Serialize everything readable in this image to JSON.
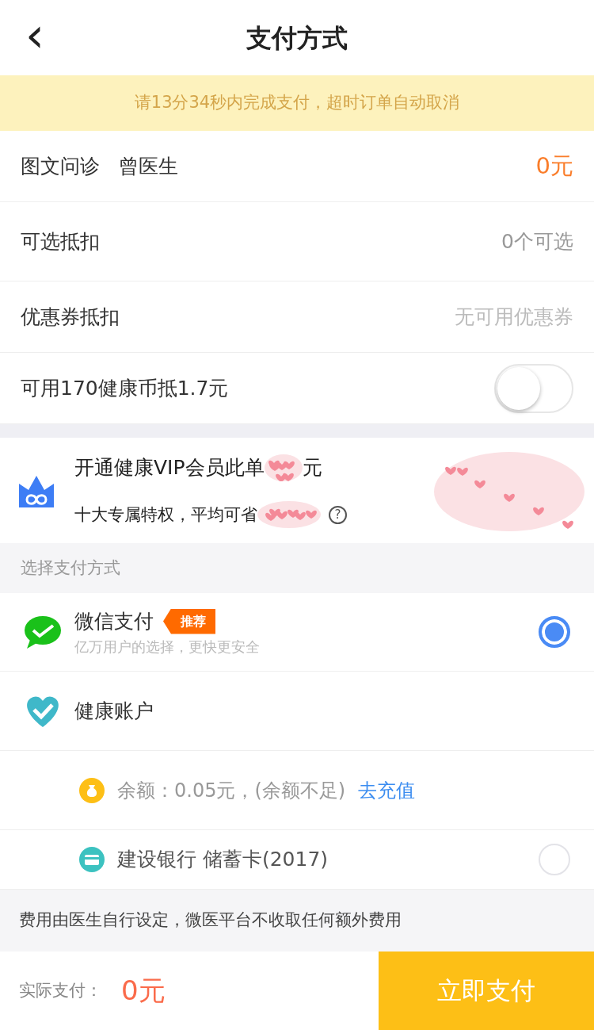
{
  "header": {
    "back": "‹",
    "title": "支付方式"
  },
  "notice": "请13分34秒内完成支付，超时订单自动取消",
  "order_rows": [
    {
      "kind": "text",
      "label": "图文问诊",
      "extra": "曾医生",
      "value": "0元",
      "highlight": true
    },
    {
      "kind": "text",
      "label": "可选抵扣",
      "value": "0个可选",
      "highlight": false
    },
    {
      "kind": "text",
      "label": "优惠券抵扣",
      "value": "无可用优惠券",
      "highlight": false,
      "muted": true
    },
    {
      "kind": "switch",
      "label": "可用170健康币抵1.7元",
      "on": false
    }
  ],
  "vip": {
    "title": "开通健康VIP会员此单",
    "title_end": "元",
    "subtitle": "十大专属特权，平均可省",
    "help": "?"
  },
  "section_label": "选择支付方式",
  "methods": [
    {
      "kind": "wechat",
      "name": "微信支付",
      "tag": "推荐",
      "desc": "亿万用户的选择，更快更安全",
      "selected": true
    },
    {
      "kind": "health",
      "name": "健康账户"
    },
    {
      "kind": "balance",
      "name": "余额：0.05元，(余额不足)",
      "link": "去充值"
    },
    {
      "kind": "card",
      "name": "建设银行 储蓄卡(2017)",
      "selected": false
    }
  ],
  "footer_note": "费用由医生自行设定，微医平台不收取任何额外费用",
  "bottom": {
    "label": "实际支付：",
    "amount": "0元",
    "button": "立即支付"
  }
}
